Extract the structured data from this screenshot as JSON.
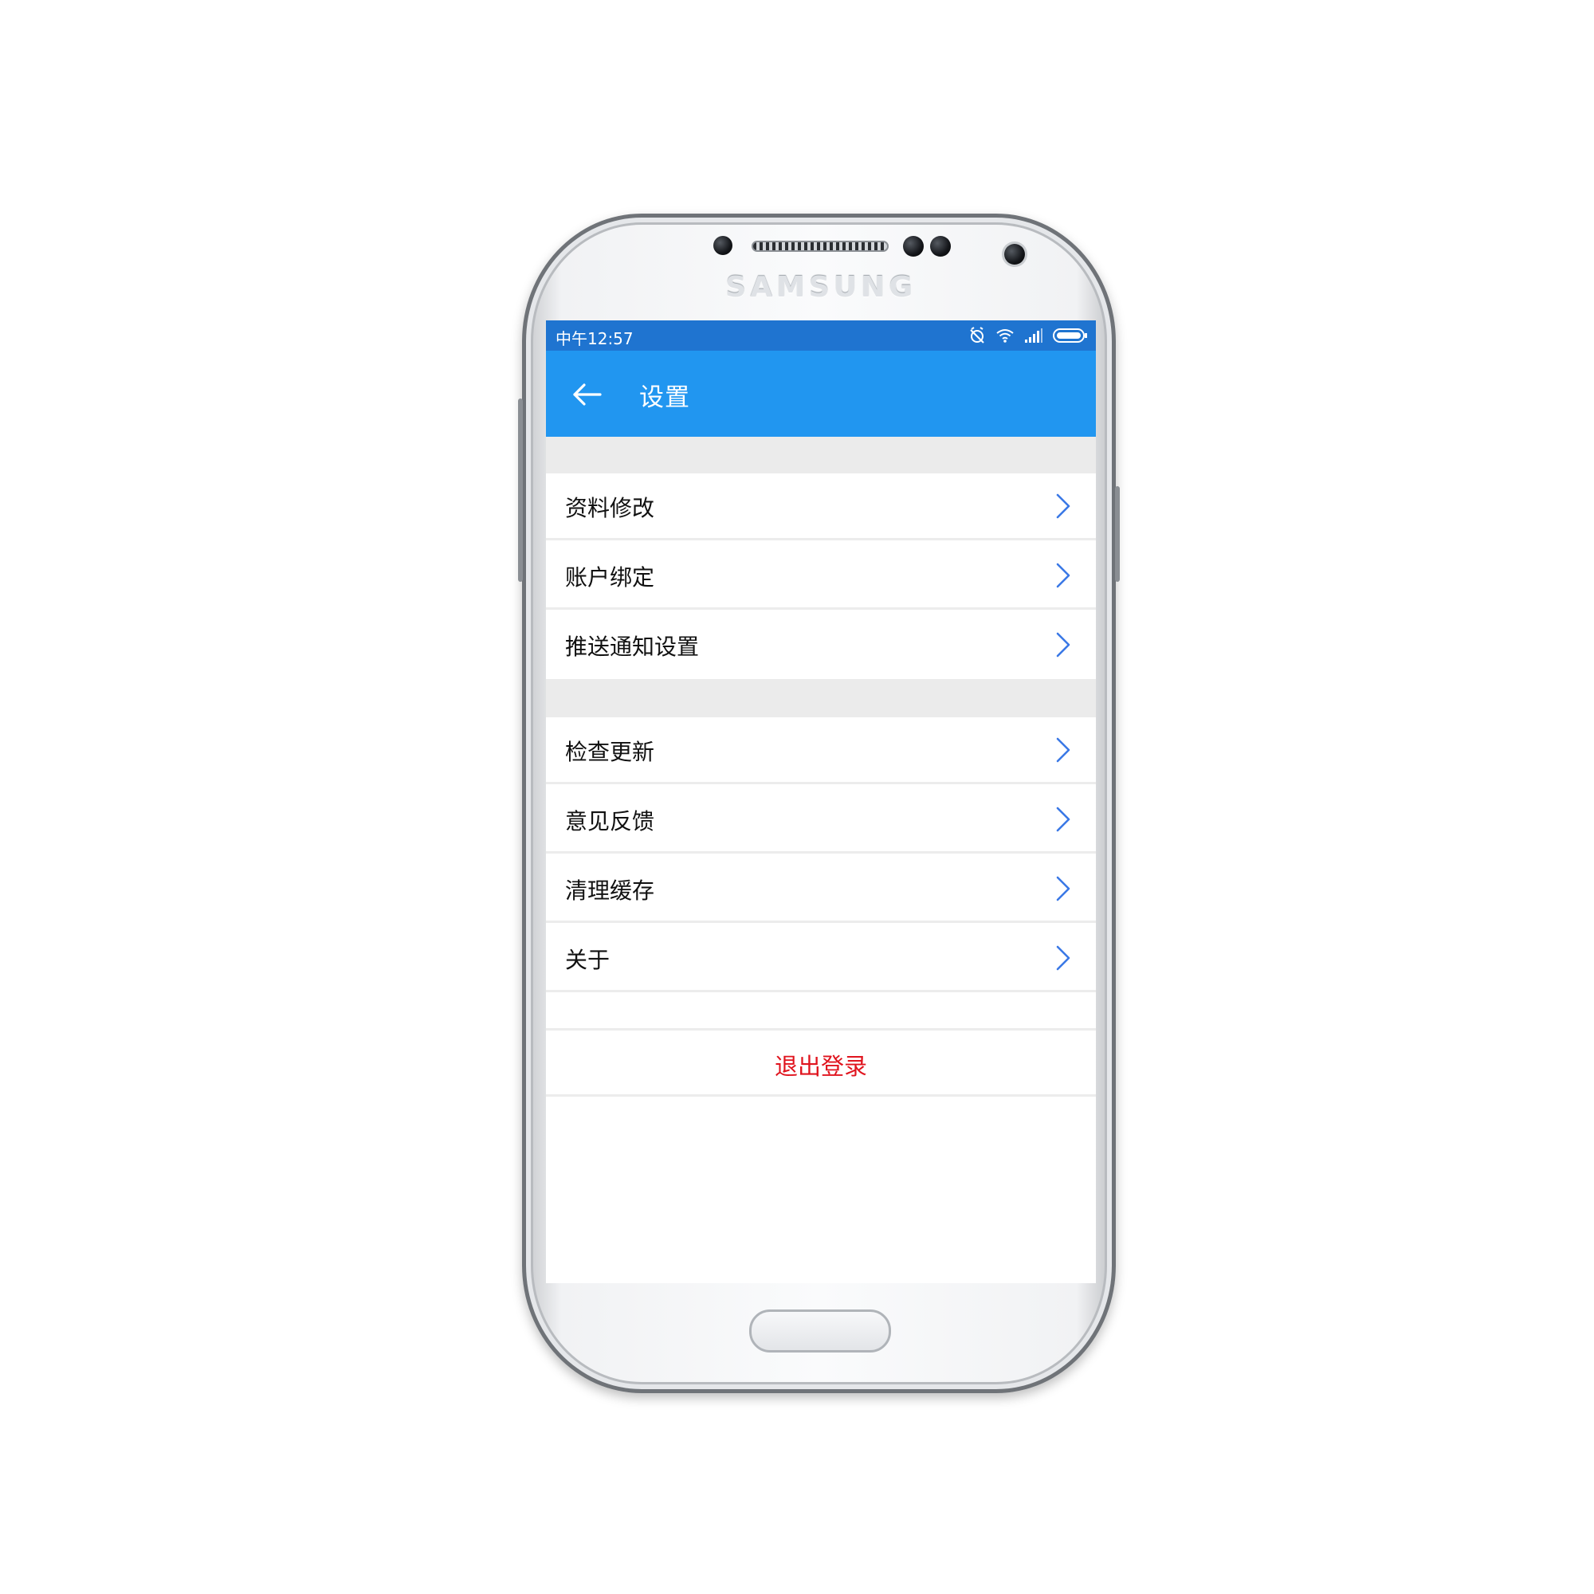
{
  "device": {
    "brand": "SAMSUNG"
  },
  "status_bar": {
    "time": "中午12:57",
    "icons": [
      "alarm-off-icon",
      "wifi-icon",
      "signal-icon",
      "battery-icon"
    ]
  },
  "app_bar": {
    "back_icon": "arrow-left-icon",
    "title": "设置"
  },
  "settings": {
    "group1": [
      {
        "label": "资料修改"
      },
      {
        "label": "账户绑定"
      },
      {
        "label": "推送通知设置"
      }
    ],
    "group2": [
      {
        "label": "检查更新"
      },
      {
        "label": "意见反馈"
      },
      {
        "label": "清理缓存"
      },
      {
        "label": "关于"
      }
    ],
    "logout_label": "退出登录"
  },
  "colors": {
    "status_bar": "#1f74d0",
    "app_bar": "#2196f0",
    "chevron": "#3a78e6",
    "logout": "#e0141e",
    "divider": "#ebebeb"
  }
}
